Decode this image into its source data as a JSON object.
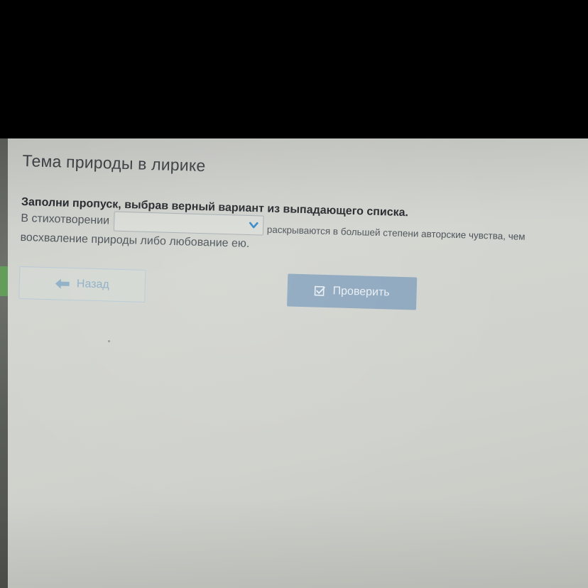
{
  "page": {
    "title": "Тема природы в лирике"
  },
  "task": {
    "instruction": "Заполни пропуск, выбрав верный вариант из выпадающего списка.",
    "sentence_before": "В стихотворении",
    "sentence_after_line1": "раскрываются в большей степени авторские чувства, чем",
    "sentence_line2": "восхваление природы либо любование ею.",
    "dropdown": {
      "selected_value": ""
    }
  },
  "buttons": {
    "back_label": "Назад",
    "check_label": "Проверить"
  },
  "icons": {
    "back": "arrow-left-icon",
    "check": "checkbox-checked-icon",
    "dropdown": "chevron-down-icon"
  },
  "colors": {
    "accent_blue": "#2f86c9",
    "check_button": "#8ea8bf",
    "back_text": "#8fb0c6"
  }
}
